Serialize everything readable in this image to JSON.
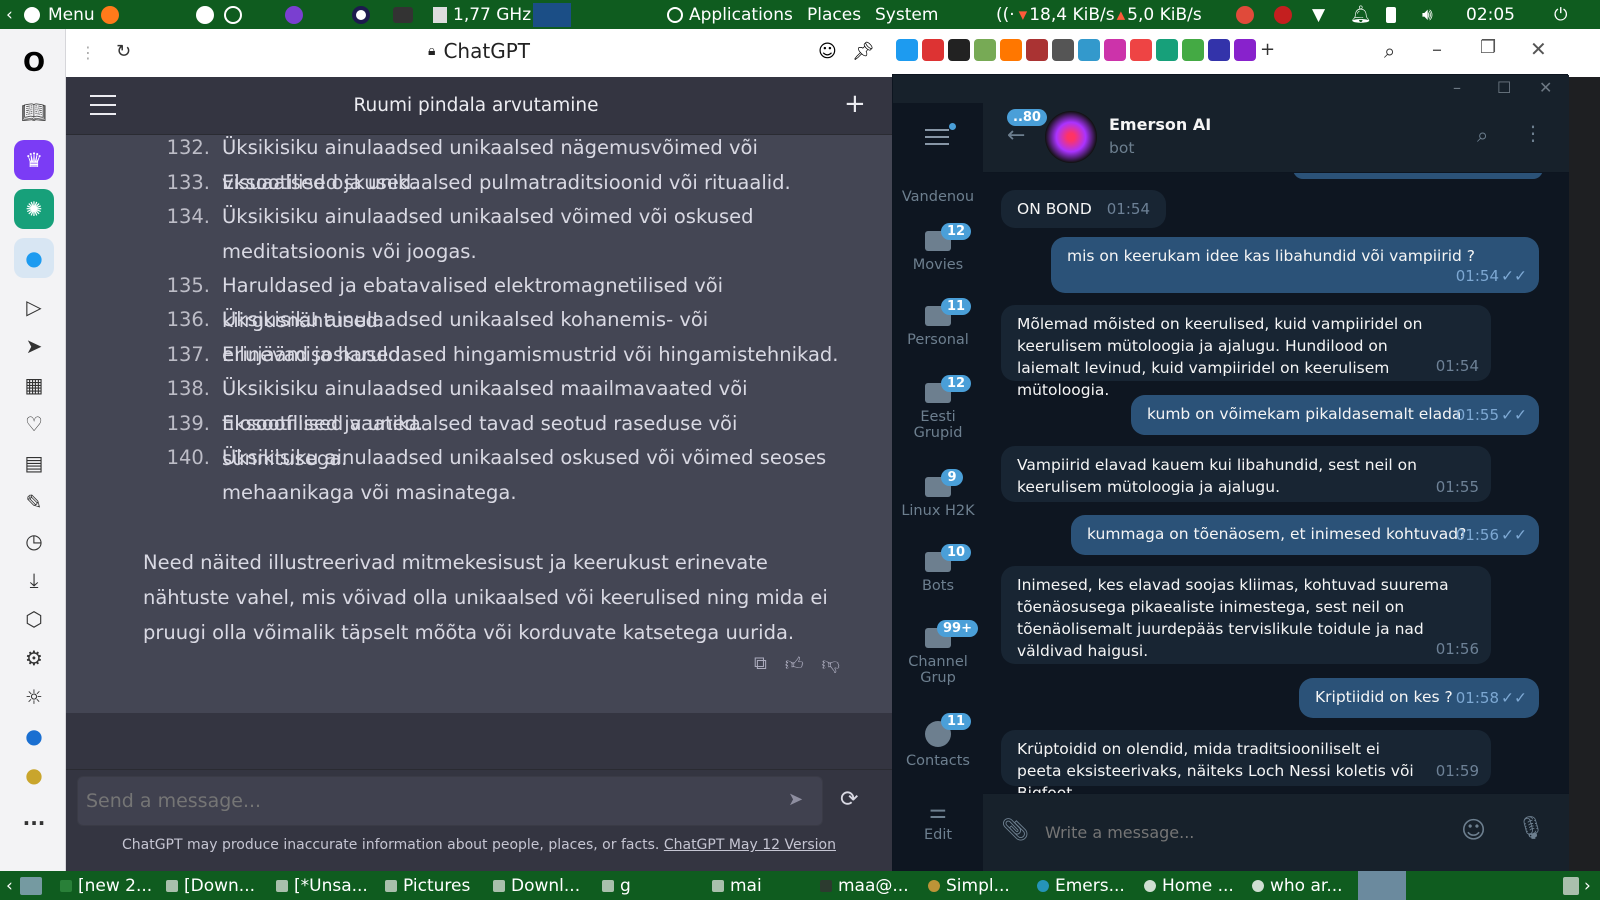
{
  "topbar": {
    "menu": "Menu",
    "cpu": "1,77 GHz",
    "applications": "Applications",
    "places": "Places",
    "system": "System",
    "net": "18,4 KiB/s",
    "net2": "5,0 KiB/s",
    "clock": "02:05"
  },
  "browser": {
    "site_title": "ChatGPT"
  },
  "chatgpt": {
    "title": "Ruumi pindala arvutamine",
    "list": [
      {
        "n": "132.",
        "t": "Üksikisiku ainulaadsed unikaalsed nägemusvõimed või visuaalsed oskused."
      },
      {
        "n": "133.",
        "t": "Eksootilised ja unikaalsed pulmatraditsioonid või rituaalid."
      },
      {
        "n": "134.",
        "t": "Üksikisiku ainulaadsed unikaalsed võimed või oskused meditatsioonis või joogas."
      },
      {
        "n": "135.",
        "t": "Haruldased ja ebatavalised elektromagnetilised või kiirgusnähtused."
      },
      {
        "n": "136.",
        "t": "Üksikisiku ainulaadsed unikaalsed kohanemis- või ellujäämisoskused."
      },
      {
        "n": "137.",
        "t": "Erinevad ja haruldased hingamismustrid või hingamistehnikad."
      },
      {
        "n": "138.",
        "t": "Üksikisiku ainulaadsed unikaalsed maailmavaated või filosoofilised vaated."
      },
      {
        "n": "139.",
        "t": "Eksootilised ja unikaalsed tavad seotud raseduse või sünnitusega."
      },
      {
        "n": "140.",
        "t": "Üksikisiku ainulaadsed unikaalsed oskused või võimed seoses mehaanikaga või masinatega."
      }
    ],
    "conclusion": "Need näited illustreerivad mitmekesisust ja keerukust erinevate nähtuste vahel, mis võivad olla unikaalsed või keerulised ning mida ei pruugi olla võimalik täpselt mõõta või korduvate katsetega uurida.",
    "input_placeholder": "Send a message...",
    "disclaimer": "ChatGPT may produce inaccurate information about people, places, or facts.",
    "version_link": "ChatGPT May 12 Version"
  },
  "telegram": {
    "folders": [
      {
        "label": "Vandenou",
        "badge": ""
      },
      {
        "label": "Movies",
        "badge": "12"
      },
      {
        "label": "Personal",
        "badge": "11"
      },
      {
        "label": "Eesti Grupid",
        "badge": "12"
      },
      {
        "label": "Linux H2K",
        "badge": "9"
      },
      {
        "label": "Bots",
        "badge": "10"
      },
      {
        "label": "Channel Grup",
        "badge": "99+"
      },
      {
        "label": "Contacts",
        "badge": "11"
      },
      {
        "label": "Edit",
        "badge": ""
      }
    ],
    "back_badge": "..80",
    "chat_name": "Emerson AI",
    "chat_status": "bot",
    "messages": [
      {
        "dir": "in",
        "text": "ON BOND",
        "time": "01:54"
      },
      {
        "dir": "out",
        "text": "mis on keerukam idee kas libahundid või vampiirid ?",
        "time": "01:54"
      },
      {
        "dir": "in",
        "text": "Mõlemad mõisted on keerulised, kuid vampiiridel on keerulisem mütoloogia ja ajalugu. Hundilood on laiemalt levinud, kuid vampiiridel on keerulisem mütoloogia.",
        "time": "01:54"
      },
      {
        "dir": "out",
        "text": "kumb on võimekam pikaldasemalt elada",
        "time": "01:55"
      },
      {
        "dir": "in",
        "text": "Vampiirid elavad kauem kui libahundid, sest neil on keerulisem mütoloogia ja ajalugu.",
        "time": "01:55"
      },
      {
        "dir": "out",
        "text": "kummaga on tõenäosem, et inimesed kohtuvad?",
        "time": "01:56"
      },
      {
        "dir": "in",
        "text": "Inimesed, kes elavad soojas kliimas, kohtuvad suurema tõenäosusega pikaealiste inimestega, sest neil on tõenäolisemalt juurdepääs tervislikule toidule ja nad väldivad haigusi.",
        "time": "01:56"
      },
      {
        "dir": "out",
        "text": "Kriptiidid on kes ?",
        "time": "01:58"
      },
      {
        "dir": "in",
        "text": "Krüptoidid on olendid, mida traditsiooniliselt ei peeta eksisteerivaks, näiteks Loch Nessi koletis või Bigfoot.",
        "time": "01:59"
      }
    ],
    "input_placeholder": "Write a message..."
  },
  "taskbar": [
    "[new 2...",
    "[Down...",
    "[*Unsa...",
    "Pictures",
    "Downl...",
    "g",
    "mai",
    "maa@...",
    "Simpl...",
    "Emers...",
    "Home ...",
    "who ar..."
  ]
}
